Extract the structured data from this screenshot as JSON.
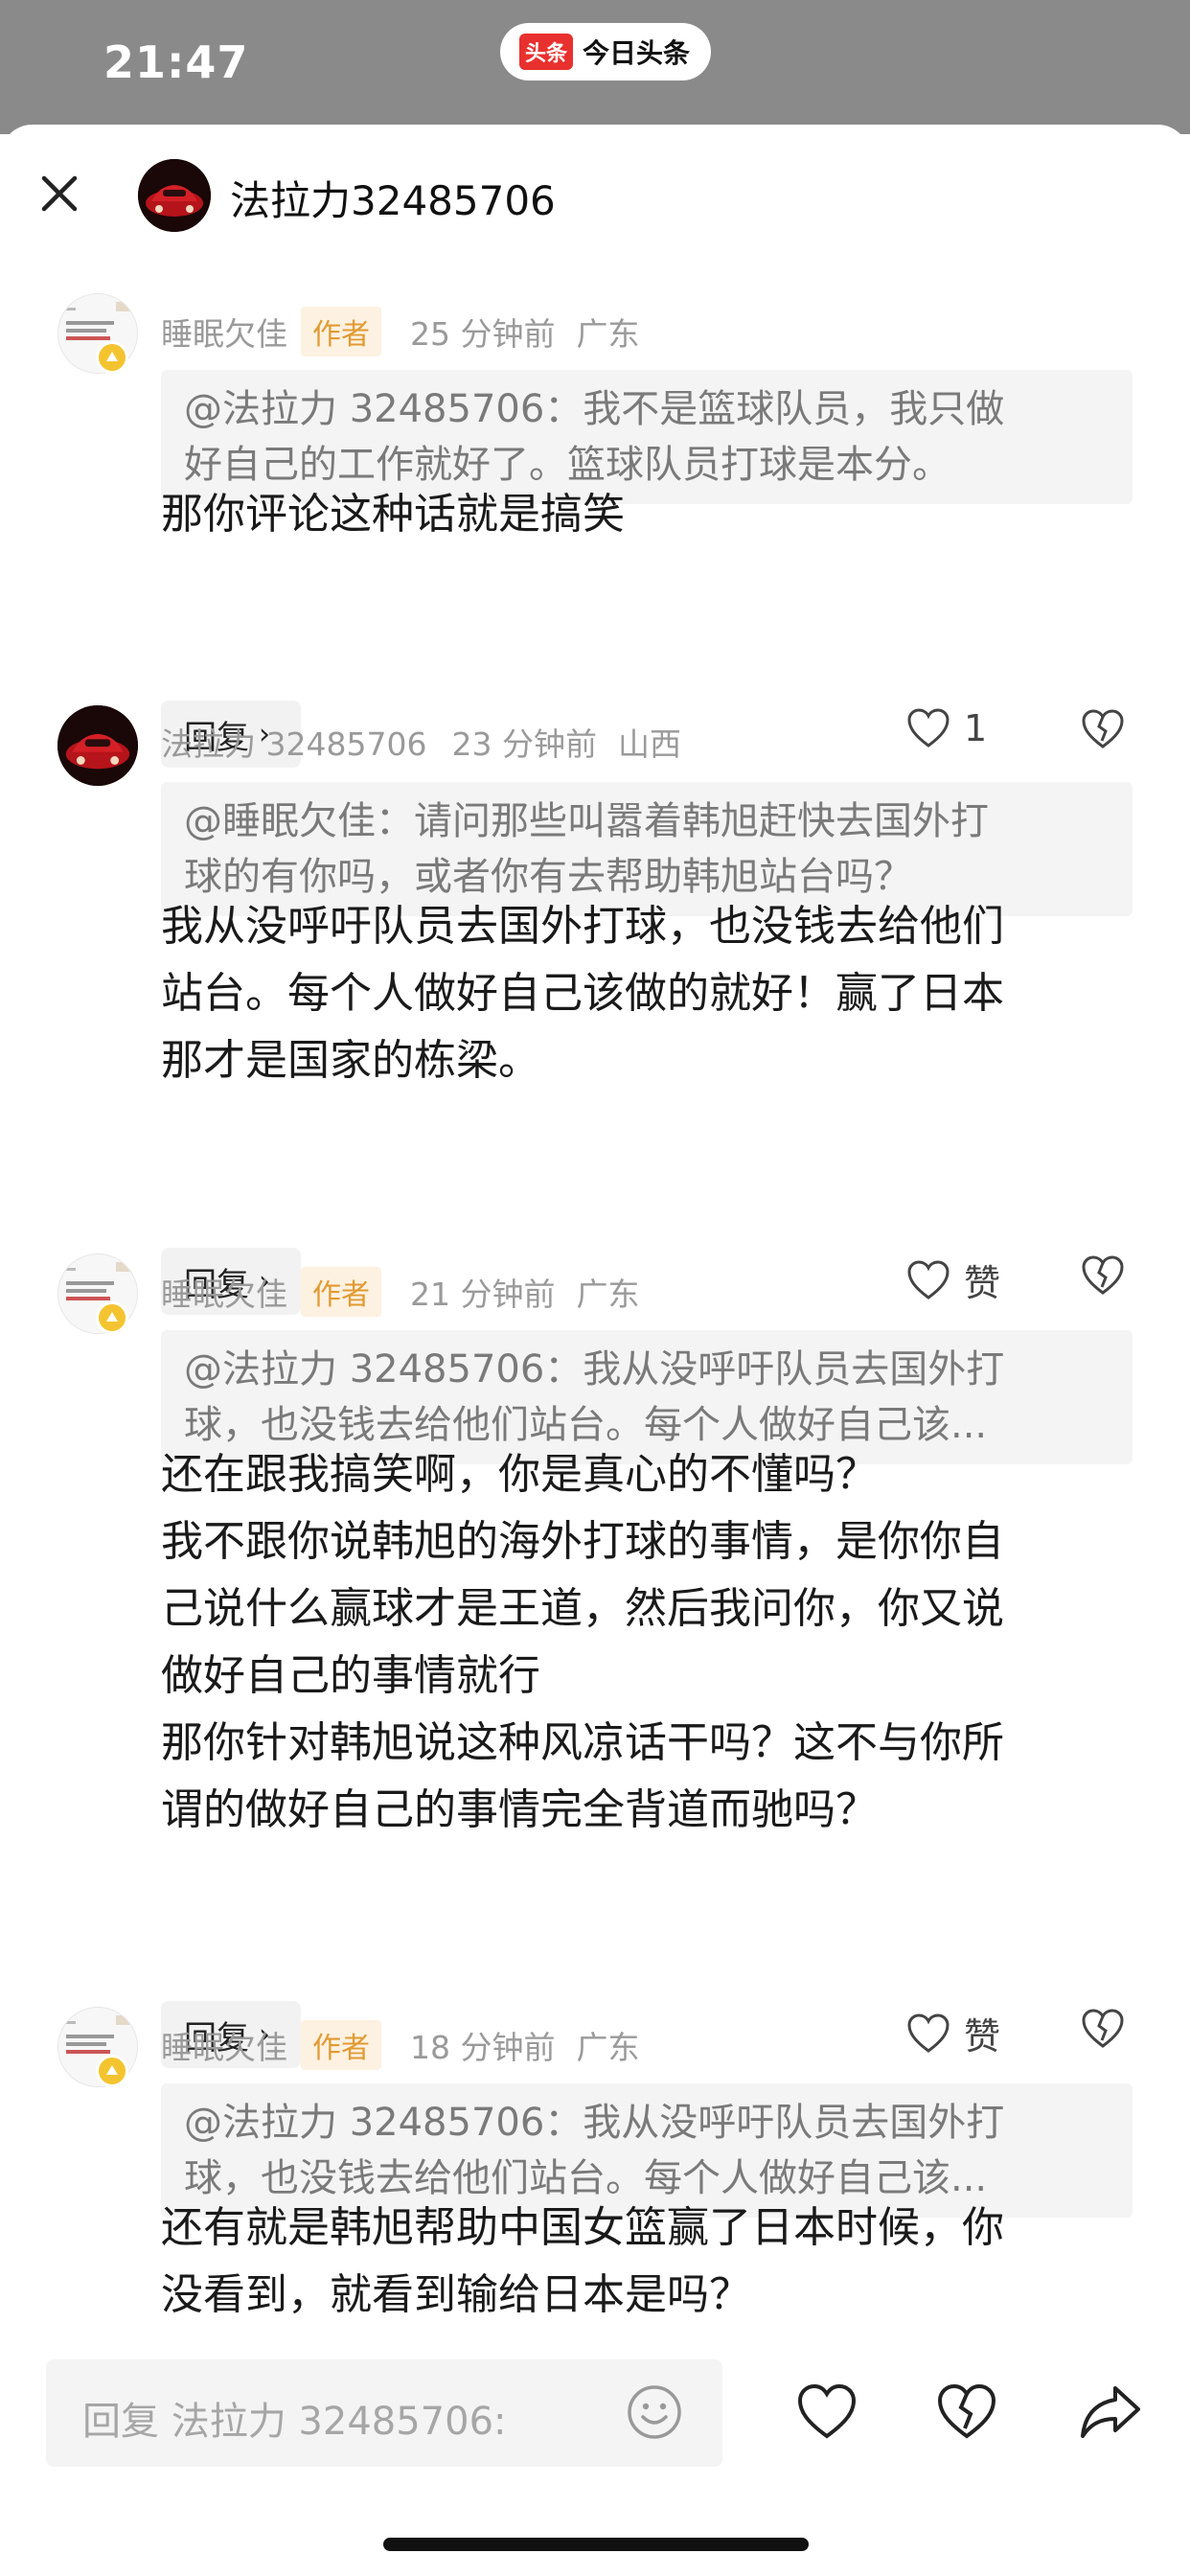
{
  "status_bar": {
    "time": "21:47",
    "app_badge": "头条",
    "app_name": "今日头条"
  },
  "header": {
    "title": "法拉力32485706",
    "close_icon": "close-icon"
  },
  "comments": [
    {
      "name": "睡眠欠佳",
      "tag": "作者",
      "time": "25 分钟前",
      "region": "广东",
      "quote": [
        "@法拉力 32485706：我不是篮球队员，我只做",
        "好自己的工作就好了。篮球队员打球是本分。"
      ],
      "body": [
        "那你评论这种话就是搞笑"
      ],
      "reply": "回复",
      "likes": "1"
    },
    {
      "name": "法拉力 32485706",
      "time": "23 分钟前",
      "region": "山西",
      "quote": [
        "@睡眠欠佳：请问那些叫嚣着韩旭赶快去国外打",
        "球的有你吗，或者你有去帮助韩旭站台吗？"
      ],
      "body": [
        "我从没呼吁队员去国外打球，也没钱去给他们",
        "站台。每个人做好自己该做的就好！赢了日本",
        "那才是国家的栋梁。"
      ],
      "reply": "回复",
      "likes": "赞"
    },
    {
      "name": "睡眠欠佳",
      "tag": "作者",
      "time": "21 分钟前",
      "region": "广东",
      "quote": [
        "@法拉力 32485706：我从没呼吁队员去国外打",
        "球，也没钱去给他们站台。每个人做好自己该..."
      ],
      "body": [
        "还在跟我搞笑啊，你是真心的不懂吗？",
        "我不跟你说韩旭的海外打球的事情，是你你自",
        "己说什么赢球才是王道，然后我问你，你又说",
        "做好自己的事情就行",
        "那你针对韩旭说这种风凉话干吗？这不与你所",
        "谓的做好自己的事情完全背道而驰吗？"
      ],
      "reply": "回复",
      "likes": "赞"
    },
    {
      "name": "睡眠欠佳",
      "tag": "作者",
      "time": "18 分钟前",
      "region": "广东",
      "quote": [
        "@法拉力 32485706：我从没呼吁队员去国外打",
        "球，也没钱去给他们站台。每个人做好自己该..."
      ],
      "body": [
        "还有就是韩旭帮助中国女篮赢了日本时候，你",
        "没看到，就看到输给日本是吗？"
      ]
    }
  ],
  "bottom_bar": {
    "placeholder": "回复 法拉力 32485706:",
    "icons": [
      "emoji-icon",
      "heart-icon",
      "broken-heart-icon",
      "share-icon"
    ]
  },
  "colors": {
    "status_bar_bg": "#8a8a8a",
    "author_tag_bg": "#fdf1e1",
    "author_tag_text": "#e19a32",
    "meta_text": "#9a9a9a",
    "quote_bg": "#f4f4f4",
    "brand_red": "#e8312f"
  }
}
